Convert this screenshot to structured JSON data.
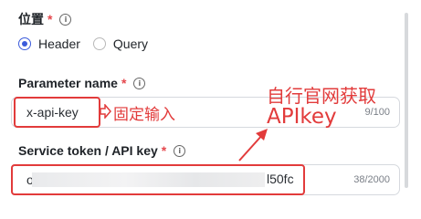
{
  "location": {
    "label": "位置",
    "required": "*",
    "options": [
      {
        "label": "Header",
        "checked": true
      },
      {
        "label": "Query",
        "checked": false
      }
    ]
  },
  "param": {
    "label": "Parameter name",
    "required": "*",
    "value": "x-api-key",
    "count": "9/100",
    "annotation": "固定输入"
  },
  "token": {
    "label": "Service token / API key",
    "required": "*",
    "value_start": "op",
    "value_end": "l50fc",
    "count": "38/2000"
  },
  "annotation_top": {
    "line1": "自行官网获取",
    "line2": "APIkey"
  },
  "colors": {
    "accent": "#3b5bdb",
    "annotation": "#e23b3b",
    "required": "#e5484d"
  }
}
